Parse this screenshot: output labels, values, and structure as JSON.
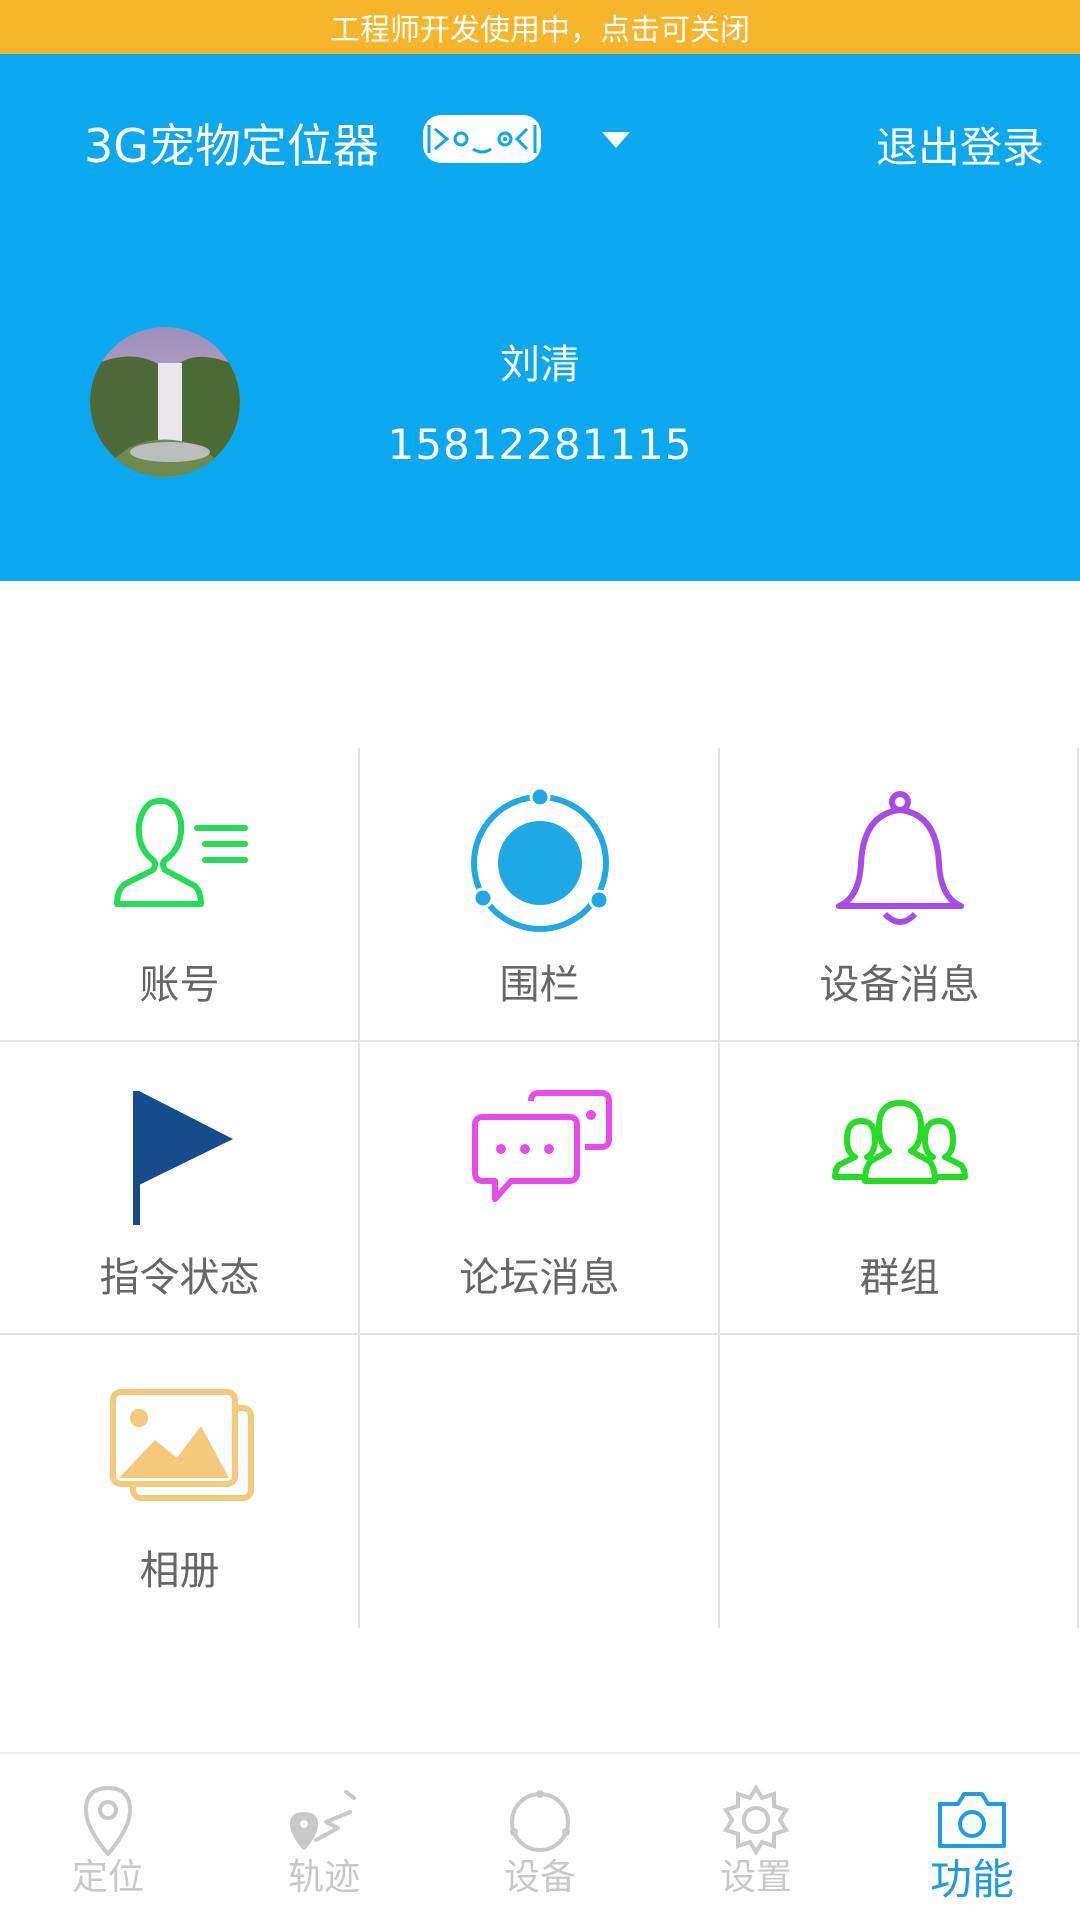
{
  "banner": {
    "text": "工程师开发使用中，点击可关闭"
  },
  "header": {
    "title": "3G宠物定位器",
    "logout_label": "退出登录",
    "user_name": "刘清",
    "user_phone": "15812281115"
  },
  "colors": {
    "banner": "#F7B52C",
    "header": "#0AA8EE",
    "nav_active": "#1E9BE6",
    "nav_inactive": "#C9C9C9"
  },
  "grid": {
    "items": [
      {
        "label": "账号",
        "icon": "account-icon",
        "color": "#22DD55"
      },
      {
        "label": "围栏",
        "icon": "fence-icon",
        "color": "#1FA8E6"
      },
      {
        "label": "设备消息",
        "icon": "bell-icon",
        "color": "#A64BEA"
      },
      {
        "label": "指令状态",
        "icon": "flag-icon",
        "color": "#164B8C"
      },
      {
        "label": "论坛消息",
        "icon": "chat-bubbles-icon",
        "color": "#E94BEA"
      },
      {
        "label": "群组",
        "icon": "group-icon",
        "color": "#22DD22"
      },
      {
        "label": "相册",
        "icon": "album-icon",
        "color": "#F4C97A"
      }
    ]
  },
  "nav": {
    "items": [
      {
        "label": "定位",
        "icon": "location-pin-icon",
        "active": false
      },
      {
        "label": "轨迹",
        "icon": "track-icon",
        "active": false
      },
      {
        "label": "设备",
        "icon": "device-icon",
        "active": false
      },
      {
        "label": "设置",
        "icon": "gear-icon",
        "active": false
      },
      {
        "label": "功能",
        "icon": "camera-icon",
        "active": true
      }
    ]
  }
}
